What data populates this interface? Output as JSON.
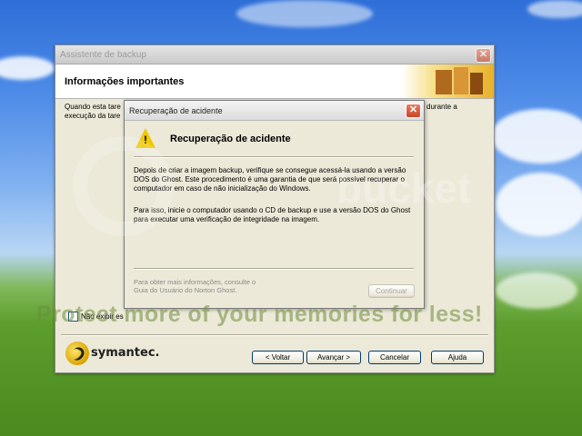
{
  "main_window": {
    "title": "Assistente de backup",
    "close_label": "✕",
    "header_title": "Informações importantes",
    "body_line1_left": "Quando esta tare",
    "body_line1_right": "durante a",
    "body_line2_left": "execução da tare",
    "checkbox_label": "Não exibir es",
    "logo_text": "symantec.",
    "buttons": {
      "back": "< Voltar",
      "next": "Avançar >",
      "cancel": "Cancelar",
      "help": "Ajuda"
    }
  },
  "dialog": {
    "title": "Recuperação de acidente",
    "close_label": "✕",
    "heading": "Recuperação de acidente",
    "warning_symbol": "!",
    "paragraph1": "Depois de criar a imagem backup, verifique se consegue acessá-la usando a versão DOS do Ghost. Este procedimento é uma garantia de que será possível recuperar o computador em caso de não inicialização do Windows.",
    "paragraph2": "Para isso, inicie o computador usando o CD de backup e use a versão DOS do Ghost para executar uma verificação de integridade na imagem.",
    "more_info": "Para obter mais informações, consulte o Guia do Usuário do Norton Ghost.",
    "continue_button": "Continuar"
  },
  "watermark": {
    "text": "Protect more of your memories for less!",
    "logo": "bucket"
  },
  "icons": {
    "warning": "warning-triangle-icon",
    "close": "close-icon",
    "logo": "symantec-logo-icon"
  },
  "colors": {
    "warning_yellow": "#f0c800",
    "close_red": "#c84426",
    "button_border": "#003c74"
  }
}
